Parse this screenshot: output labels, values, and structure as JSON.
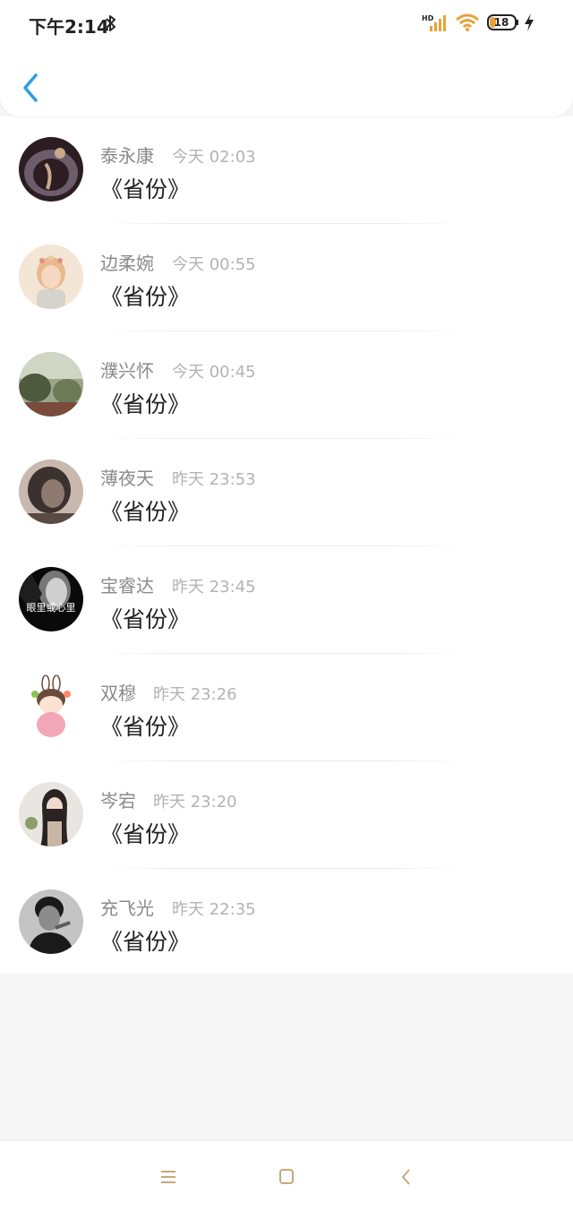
{
  "status_bar": {
    "time": "下午2:14",
    "battery": "18",
    "icons": [
      "bluetooth-icon",
      "hd-signal-icon",
      "wifi-icon",
      "battery-icon",
      "charging-icon"
    ]
  },
  "header": {
    "back_icon": "chevron-left-icon"
  },
  "messages": [
    {
      "name": "泰永康",
      "time": "今天 02:03",
      "text": "《省份》",
      "avatar_colors": [
        "#2b1d22",
        "#6d5c6a",
        "#caa98b"
      ]
    },
    {
      "name": "边柔婉",
      "time": "今天 00:55",
      "text": "《省份》",
      "avatar_colors": [
        "#f4e6d6",
        "#e8b98f",
        "#d6d2cc"
      ]
    },
    {
      "name": "濮兴怀",
      "time": "今天 00:45",
      "text": "《省份》",
      "avatar_colors": [
        "#4d5a3c",
        "#9aa68a",
        "#7a4a3a"
      ]
    },
    {
      "name": "薄夜天",
      "time": "昨天 23:53",
      "text": "《省份》",
      "avatar_colors": [
        "#3b3230",
        "#8f7a70",
        "#c9b8ae"
      ]
    },
    {
      "name": "宝睿达",
      "time": "昨天 23:45",
      "text": "《省份》",
      "avatar_colors": [
        "#0a0a0a",
        "#777777",
        "#cfcfcf"
      ],
      "avatar_caption": "眼里或心里"
    },
    {
      "name": "双穆",
      "time": "昨天 23:26",
      "text": "《省份》",
      "avatar_colors": [
        "#ffffff",
        "#f2a6b8",
        "#6b4a3a"
      ]
    },
    {
      "name": "岑宕",
      "time": "昨天 23:20",
      "text": "《省份》",
      "avatar_colors": [
        "#e9e6e1",
        "#2a2322",
        "#c8b6a4"
      ]
    },
    {
      "name": "充飞光",
      "time": "昨天 22:35",
      "text": "《省份》",
      "avatar_colors": [
        "#1a1a1a",
        "#5c5c5c",
        "#c4c4c4"
      ]
    }
  ],
  "nav_bar": {
    "icons": [
      "menu-icon",
      "home-icon",
      "back-icon"
    ],
    "color": "#c9a779"
  },
  "colors": {
    "accent": "#2f9be8",
    "name": "#8a8a8a",
    "time": "#b3b3b3",
    "message": "#222222"
  }
}
